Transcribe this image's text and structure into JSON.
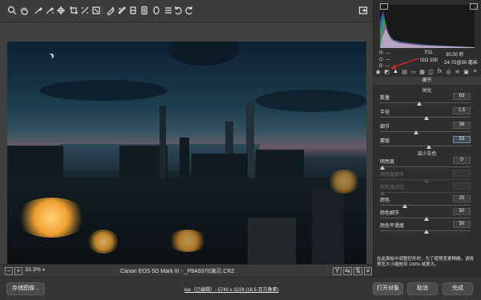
{
  "toolbar": {
    "tools": [
      "zoom-icon",
      "hand-icon",
      "white-balance-icon",
      "color-sampler-icon",
      "target-adjust-icon",
      "crop-icon",
      "straighten-icon",
      "spot-removal-icon",
      "red-eye-icon",
      "adjustment-brush-icon",
      "graduated-filter-icon",
      "radial-filter-icon",
      "preferences-icon",
      "rotate-ccw-icon",
      "rotate-cw-icon"
    ],
    "fullscreen_icon": "fullscreen-icon"
  },
  "status": {
    "zoom": "33.3%",
    "filename": "Canon EOS 5D Mark III - _P8A9370演示.CR2"
  },
  "bottom": {
    "save_label": "存储图像...",
    "workflow_text": "lee（已编辑）- 5740 x 3229 (18.5 百万像素)",
    "open_label": "打开对象",
    "cancel_label": "取消",
    "done_label": "完成"
  },
  "camera": {
    "r_label": "R:",
    "g_label": "G:",
    "b_label": "B:",
    "r_value": "---",
    "g_value": "---",
    "b_value": "---",
    "aperture": "f/11",
    "shutter": "30.00 秒",
    "iso": "ISO 200",
    "lens": "24-70@30 毫米"
  },
  "panel": {
    "section_title": "细节",
    "sharpen_title": "锐化",
    "noise_title": "减少杂色",
    "sharpen": [
      {
        "label": "数量",
        "value": "63",
        "pos": 0.42,
        "active": false,
        "dim": false
      },
      {
        "label": "半径",
        "value": "1.5",
        "pos": 0.5,
        "active": false,
        "dim": false
      },
      {
        "label": "细节",
        "value": "38",
        "pos": 0.38,
        "active": false,
        "dim": false
      },
      {
        "label": "蒙版",
        "value": "53",
        "pos": 0.53,
        "active": true,
        "dim": false
      }
    ],
    "noise": [
      {
        "label": "明亮度",
        "value": "0",
        "pos": 0.0,
        "active": false,
        "dim": false
      },
      {
        "label": "明亮度细节",
        "value": "",
        "pos": 0.5,
        "active": false,
        "dim": true
      },
      {
        "label": "明亮度对比",
        "value": "",
        "pos": 0.0,
        "active": false,
        "dim": true
      },
      {
        "label": "颜色",
        "value": "25",
        "pos": 0.25,
        "active": false,
        "dim": false
      },
      {
        "label": "颜色细节",
        "value": "50",
        "pos": 0.5,
        "active": false,
        "dim": false
      },
      {
        "label": "颜色平滑度",
        "value": "50",
        "pos": 0.5,
        "active": false,
        "dim": false
      }
    ],
    "note": "在此面板中调整控件时，为了使预览更精确，请将预览大小缩放到 100% 或更大。"
  },
  "colors": {
    "accent_arrow": "#e0242f",
    "panel_bg": "#2e2e2e",
    "active_field": "#6a8aa6"
  }
}
